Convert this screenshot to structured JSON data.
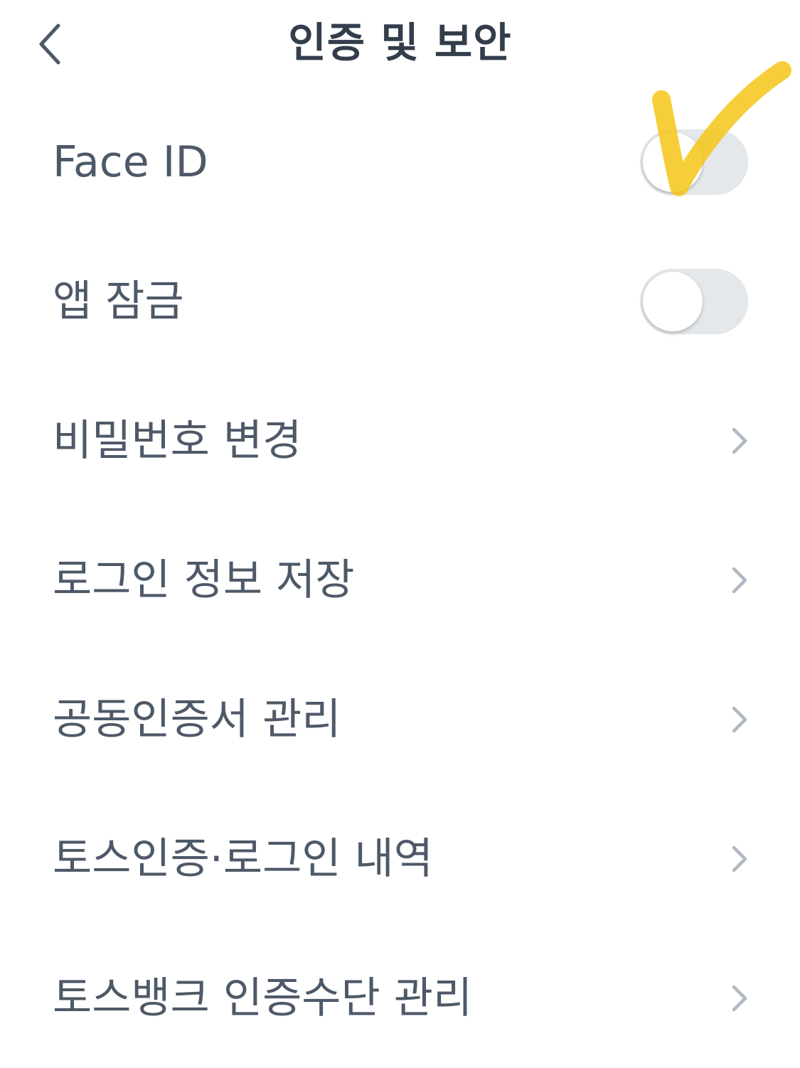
{
  "header": {
    "title": "인증 및 보안",
    "back_icon": "chevron-left-icon"
  },
  "settings": {
    "face_id": {
      "label": "Face ID",
      "toggle_on": false
    },
    "app_lock": {
      "label": "앱 잠금",
      "toggle_on": false
    }
  },
  "menu": [
    {
      "label": "비밀번호 변경",
      "icon": "chevron-right-icon"
    },
    {
      "label": "로그인 정보 저장",
      "icon": "chevron-right-icon"
    },
    {
      "label": "공동인증서 관리",
      "icon": "chevron-right-icon"
    },
    {
      "label": "토스인증·로그인 내역",
      "icon": "chevron-right-icon"
    },
    {
      "label": "토스뱅크 인증수단 관리",
      "icon": "chevron-right-icon"
    }
  ],
  "colors": {
    "text": "#4e5968",
    "title": "#333d4b",
    "toggle_off": "#e5e8eb",
    "chevron": "#b0b8c1",
    "annotation": "#f5c518"
  }
}
